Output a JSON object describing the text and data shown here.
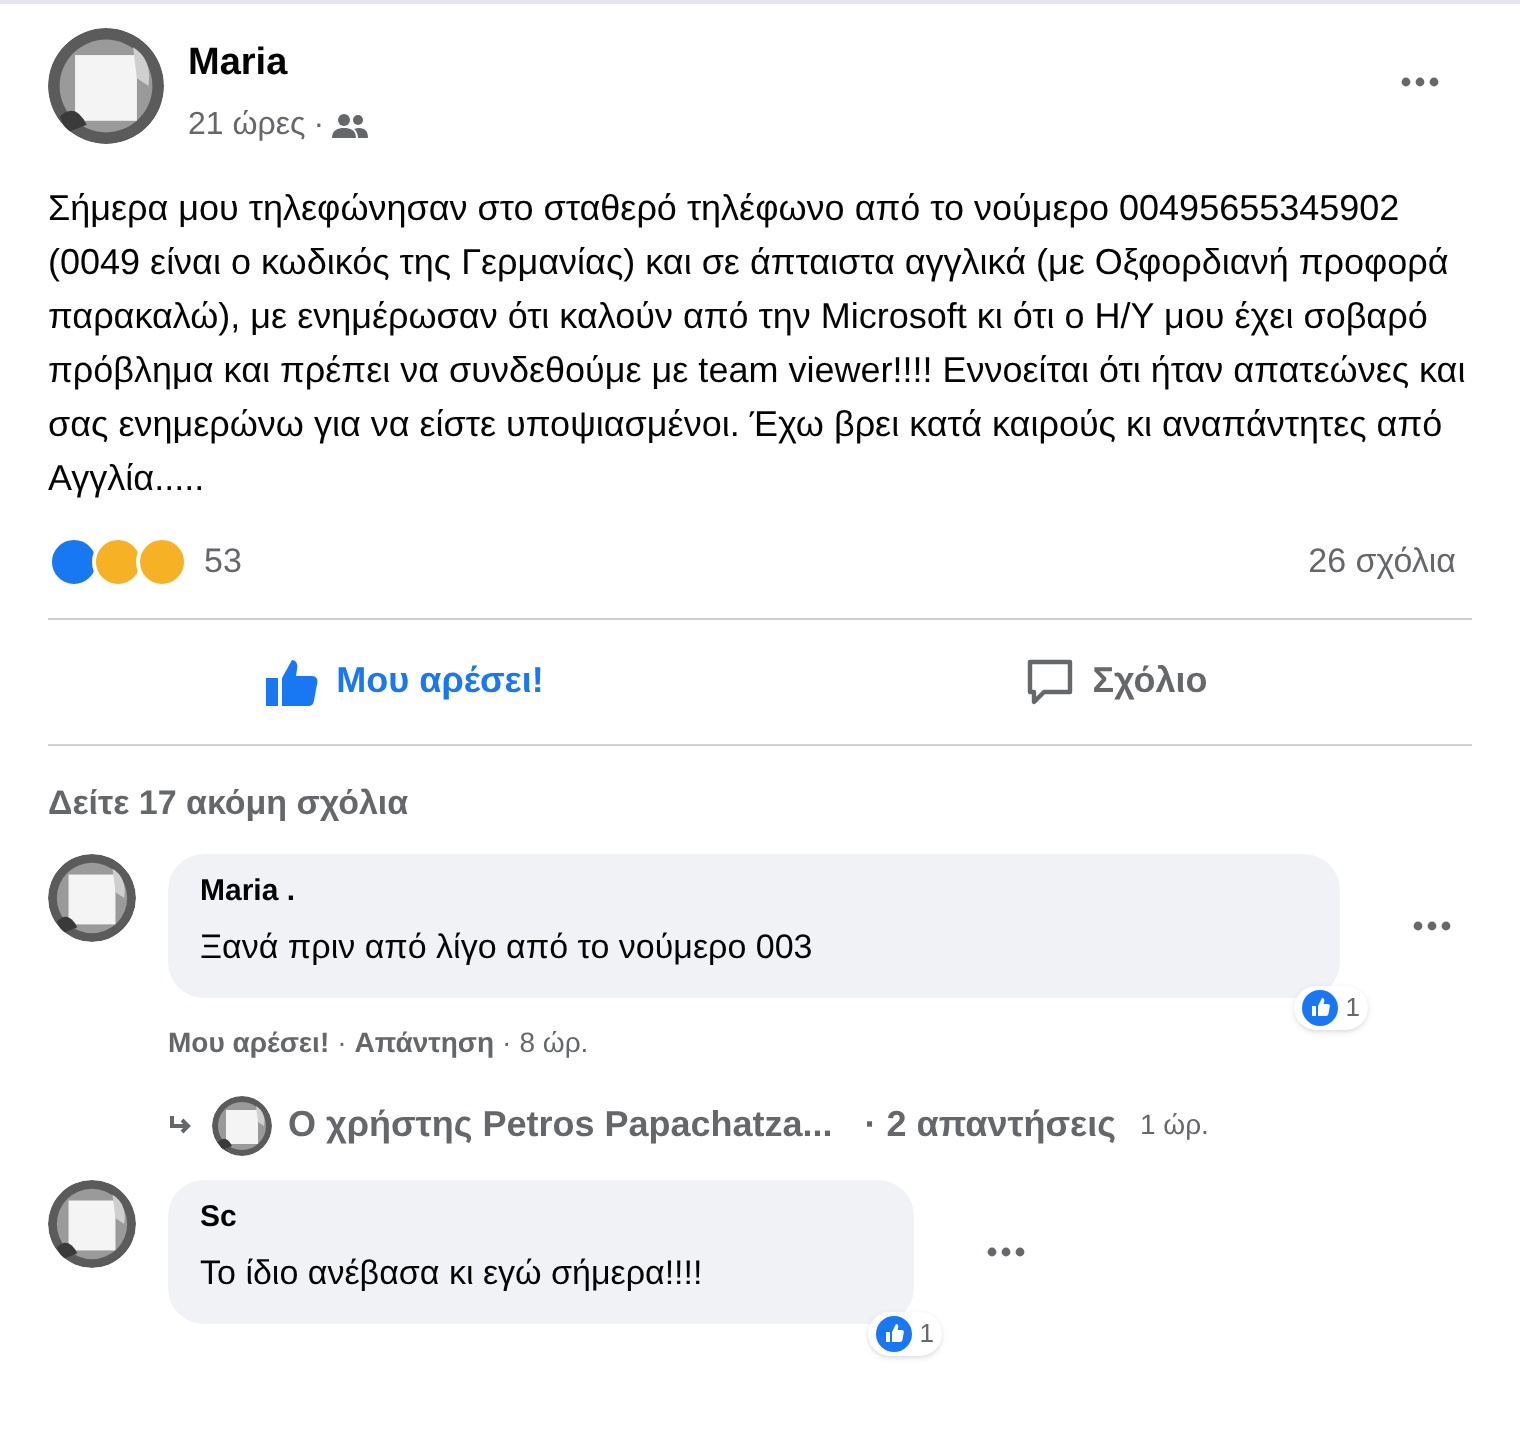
{
  "post": {
    "author": "Maria",
    "time": "21 ώρες",
    "separator": "·",
    "body": [
      "Σήμερα μου τηλεφώνησαν στο σταθερό τηλέφωνο από το νούμερο 00495655345902 (0049 είναι ο κωδικός της Γερμανίας) και σε άπταιστα αγγλικά (με Οξφορδιανή προφορά παρακαλώ),  με ενημέρωσαν ότι καλούν από την Microsoft κι ότι ο Η/Υ μου έχει σοβαρό πρόβλημα και πρέπει να συνδεθούμε με team viewer!!!! Εννοείται ότι ήταν απατεώνες και σας ενημερώνω για να είστε υποψιασμένοι. Έχω βρει κατά καιρούς κι αναπάντητες  από Αγγλία....."
    ],
    "reaction_count": "53",
    "comment_count": "26 σχόλια"
  },
  "actions": [
    {
      "label": "Μου αρέσει!",
      "kind": "like",
      "selected": true
    },
    {
      "label": "Σχόλιο",
      "kind": "comment",
      "selected": false
    }
  ],
  "more_comments": "Δείτε 17 ακόμη σχόλια",
  "comments": [
    {
      "author": "Maria .",
      "text": "Ξανά πριν από λίγο από το νούμερο 003",
      "likes": "1",
      "meta_separator": "·",
      "meta": [
        {
          "label": "Μου αρέσει!"
        },
        {
          "label": "Απάντηση"
        },
        {
          "label": "8 ώρ."
        }
      ],
      "reply_summary": {
        "text": "Ο χρήστης Petros Papachatza...",
        "count": "· 2 απαντήσεις",
        "time": "1 ώρ."
      }
    },
    {
      "author": "Sc",
      "text": "Το ίδιο ανέβασα κι εγώ σήμερα!!!!",
      "likes": "1"
    }
  ]
}
